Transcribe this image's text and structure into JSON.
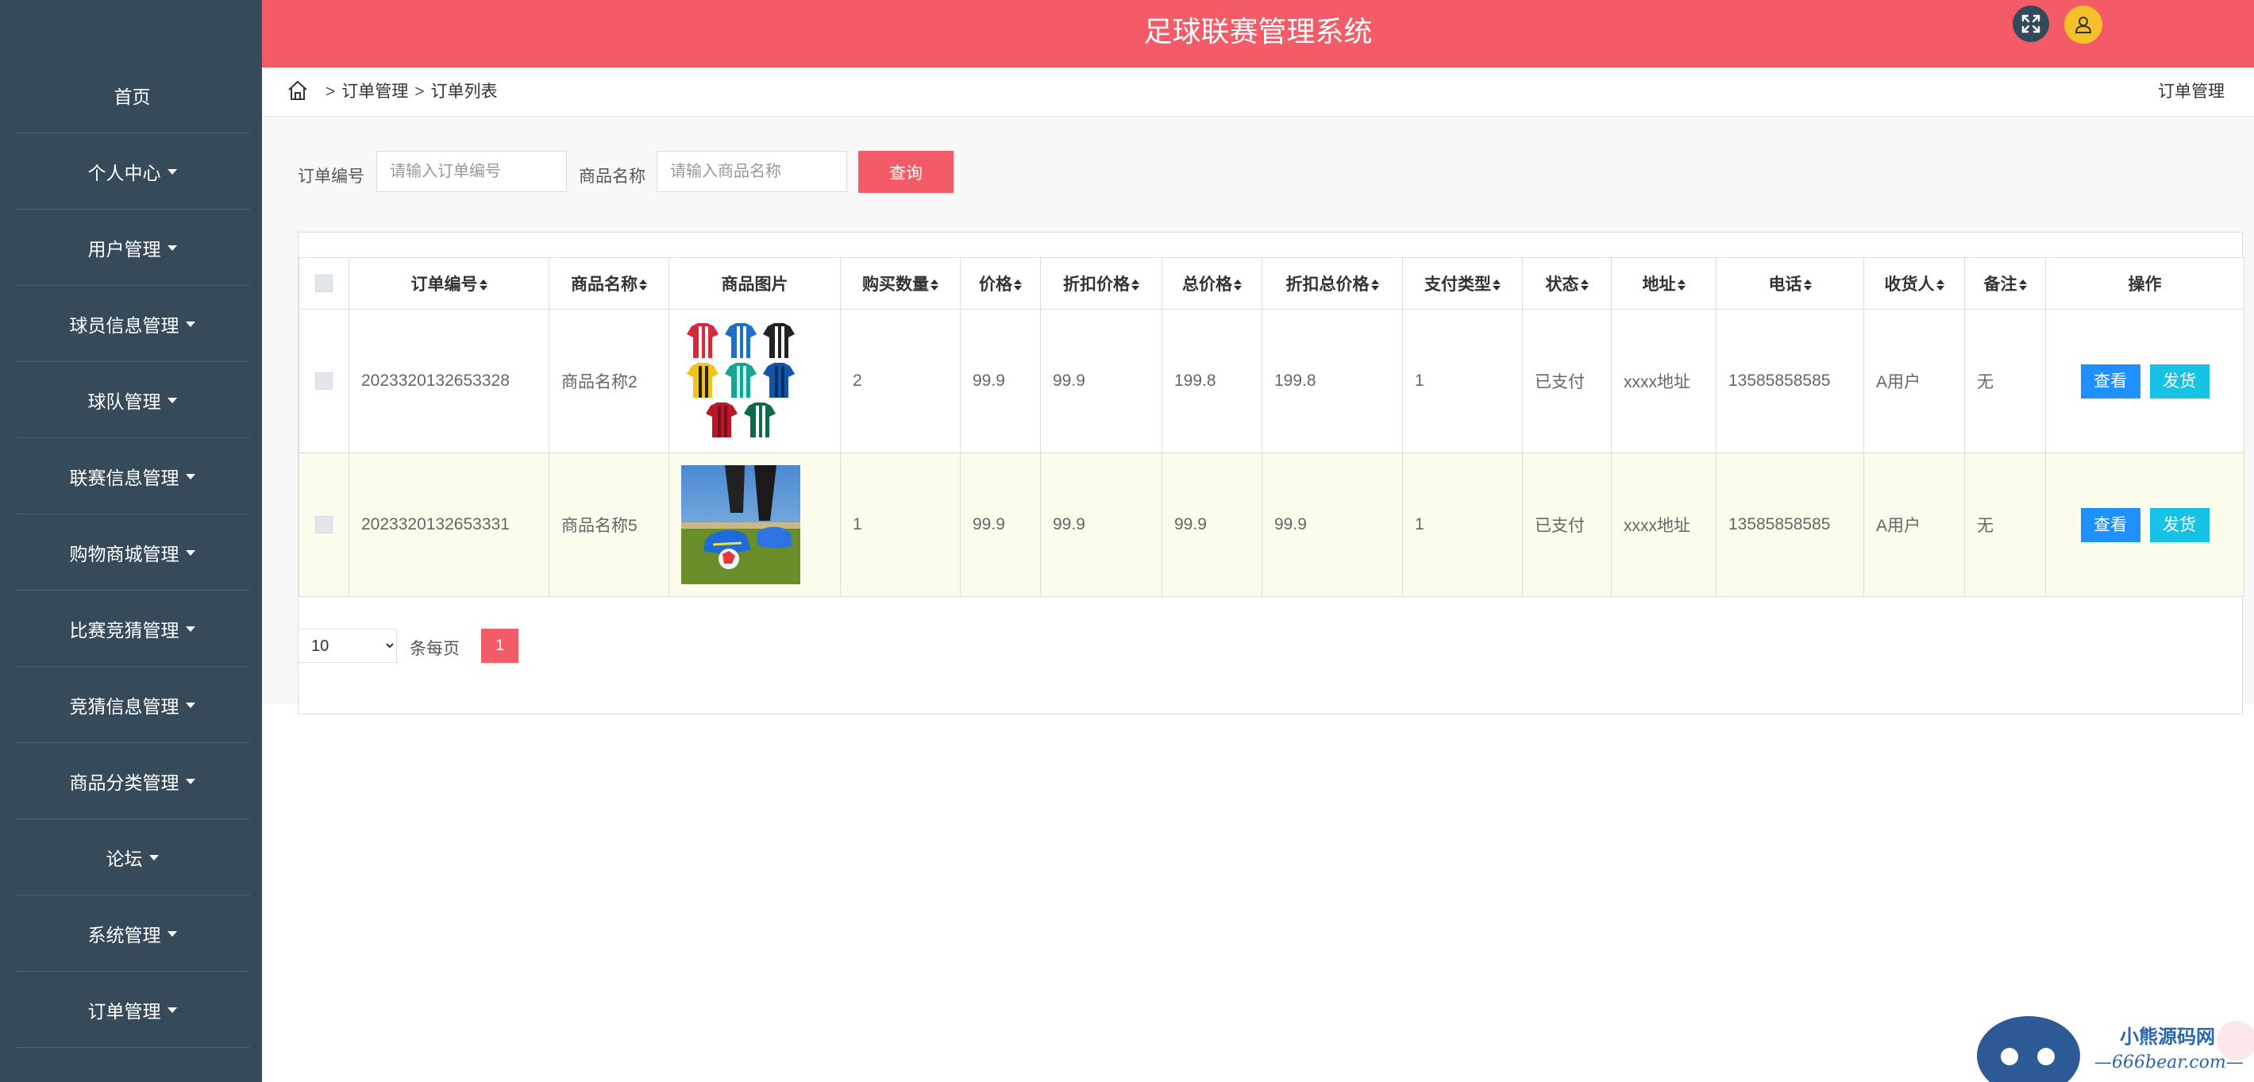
{
  "header": {
    "title": "足球联赛管理系统"
  },
  "sidebar": {
    "items": [
      {
        "label": "首页",
        "has_caret": false
      },
      {
        "label": "个人中心",
        "has_caret": true
      },
      {
        "label": "用户管理",
        "has_caret": true
      },
      {
        "label": "球员信息管理",
        "has_caret": true
      },
      {
        "label": "球队管理",
        "has_caret": true
      },
      {
        "label": "联赛信息管理",
        "has_caret": true
      },
      {
        "label": "购物商城管理",
        "has_caret": true
      },
      {
        "label": "比赛竞猜管理",
        "has_caret": true
      },
      {
        "label": "竞猜信息管理",
        "has_caret": true
      },
      {
        "label": "商品分类管理",
        "has_caret": true
      },
      {
        "label": "论坛",
        "has_caret": true
      },
      {
        "label": "系统管理",
        "has_caret": true
      },
      {
        "label": "订单管理",
        "has_caret": true
      }
    ]
  },
  "breadcrumb": {
    "sep": ">",
    "items": [
      "订单管理",
      "订单列表"
    ],
    "right": "订单管理"
  },
  "search": {
    "order_no_label": "订单编号",
    "order_no_placeholder": "请输入订单编号",
    "goods_name_label": "商品名称",
    "goods_name_placeholder": "请输入商品名称",
    "query_label": "查询"
  },
  "table": {
    "columns": [
      "订单编号",
      "商品名称",
      "商品图片",
      "购买数量",
      "价格",
      "折扣价格",
      "总价格",
      "折扣总价格",
      "支付类型",
      "状态",
      "地址",
      "电话",
      "收货人",
      "备注",
      "操作"
    ],
    "rows": [
      {
        "order_no": "2023320132653328",
        "goods_name": "商品名称2",
        "image": "jerseys",
        "quantity": "2",
        "price": "99.9",
        "discount_price": "99.9",
        "total": "199.8",
        "discount_total": "199.8",
        "pay_type": "1",
        "status": "已支付",
        "address": "xxxx地址",
        "phone": "13585858585",
        "receiver": "A用户",
        "remark": "无"
      },
      {
        "order_no": "2023320132653331",
        "goods_name": "商品名称5",
        "image": "football-boots",
        "quantity": "1",
        "price": "99.9",
        "discount_price": "99.9",
        "total": "99.9",
        "discount_total": "99.9",
        "pay_type": "1",
        "status": "已支付",
        "address": "xxxx地址",
        "phone": "13585858585",
        "receiver": "A用户",
        "remark": "无"
      }
    ],
    "view_label": "查看",
    "ship_label": "发货"
  },
  "pagination": {
    "page_size": "10",
    "page_size_options": [
      "10"
    ],
    "per_page_label": "条每页",
    "current_page": "1"
  },
  "watermark": {
    "line1": "小熊源码网",
    "line2": "—666bear.com—"
  },
  "colors": {
    "accent": "#f35b66",
    "sidebar": "#364a59",
    "view_button": "#1e90ff",
    "ship_button": "#17c2e4",
    "user_avatar": "#f6c02b"
  }
}
